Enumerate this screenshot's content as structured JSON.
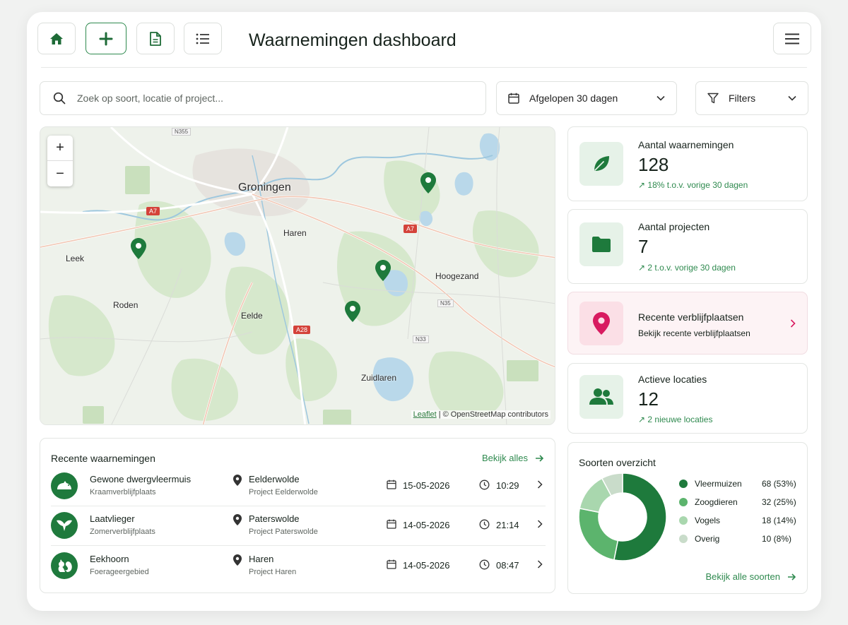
{
  "header": {
    "title": "Waarnemingen dashboard"
  },
  "search": {
    "placeholder": "Zoek op soort, locatie of project..."
  },
  "date_filter": {
    "label": "Afgelopen 30 dagen"
  },
  "filters": {
    "label": "Filters"
  },
  "map": {
    "labels": {
      "groningen": "Groningen",
      "haren": "Haren",
      "leek": "Leek",
      "roden": "Roden",
      "eelde": "Eelde",
      "hoogezand": "Hoogezand",
      "zuidlaren": "Zuidlaren",
      "a7_west": "A7",
      "a7_east": "A7",
      "a28": "A28",
      "n355": "N355",
      "n35": "N35",
      "n33": "N33"
    },
    "zoom_in": "+",
    "zoom_out": "−",
    "attribution_link": "Leaflet",
    "attribution_text": "| © OpenStreetMap contributors"
  },
  "stats": [
    {
      "title": "Aantal waarnemingen",
      "value": "128",
      "change": "18% t.o.v. vorige 30 dagen"
    },
    {
      "title": "Aantal projecten",
      "value": "7",
      "change": "2 t.o.v. vorige 30 dagen"
    },
    {
      "title": "Recente verblijfplaatsen",
      "subtitle": "Bekijk recente verblijfplaatsen"
    },
    {
      "title": "Actieve locaties",
      "value": "12",
      "change": "2 nieuwe locaties"
    }
  ],
  "recent": {
    "title": "Recente waarnemingen",
    "view_all": "Bekijk alles",
    "rows": [
      {
        "species": "Gewone dwergvleermuis",
        "type": "Kraamverblijfplaats",
        "location": "Eelderwolde",
        "project": "Project Eelderwolde",
        "date": "15-05-2026",
        "time": "10:29"
      },
      {
        "species": "Laatvlieger",
        "type": "Zomerverblijfplaats",
        "location": "Paterswolde",
        "project": "Project Paterswolde",
        "date": "14-05-2026",
        "time": "21:14"
      },
      {
        "species": "Eekhoorn",
        "type": "Foerageergebied",
        "location": "Haren",
        "project": "Project Haren",
        "date": "14-05-2026",
        "time": "08:47"
      }
    ]
  },
  "species_overview": {
    "title": "Soorten overzicht",
    "view_all": "Bekijk alle soorten",
    "items": [
      {
        "name": "Vleermuizen",
        "value": "68 (53%)",
        "count": 68,
        "color": "#1e7a3c"
      },
      {
        "name": "Zoogdieren",
        "value": "32 (25%)",
        "count": 32,
        "color": "#5cb46d"
      },
      {
        "name": "Vogels",
        "value": "18 (14%)",
        "count": 18,
        "color": "#a9d7ae"
      },
      {
        "name": "Overig",
        "value": "10 (8%)",
        "count": 10,
        "color": "#c9dcca"
      }
    ]
  },
  "colors": {
    "accent": "#2f8a4f",
    "pin": "#1e7a3c",
    "pink": "#d81b60"
  }
}
